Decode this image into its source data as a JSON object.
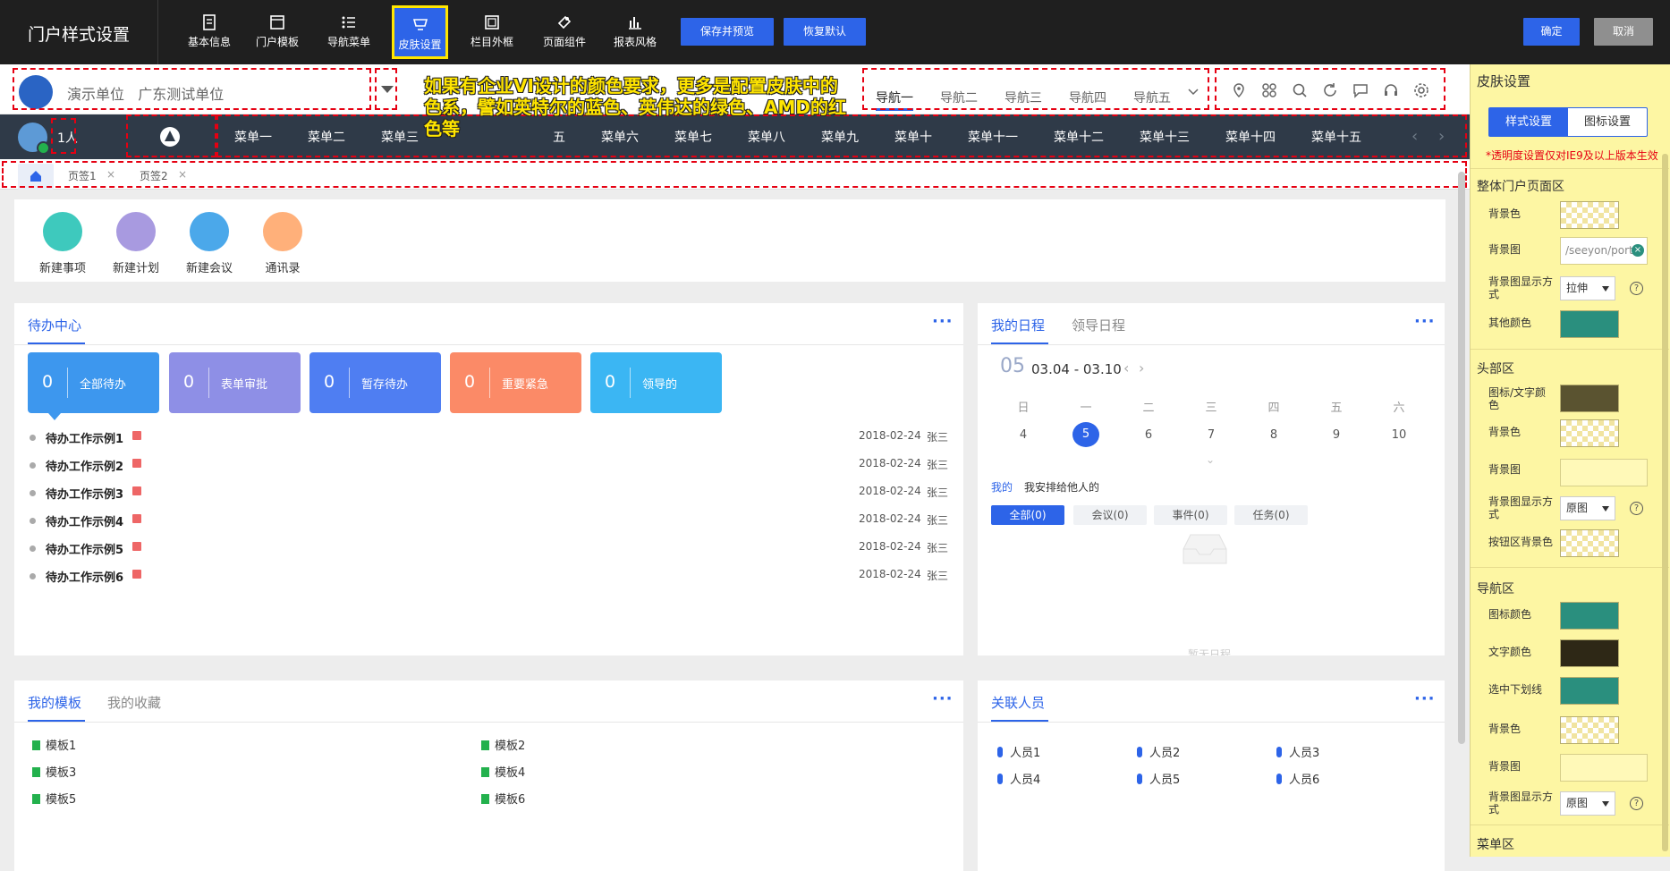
{
  "toolbar": {
    "title": "门户样式设置",
    "tools": [
      "基本信息",
      "门户模板",
      "导航菜单",
      "皮肤设置",
      "栏目外框",
      "页面组件",
      "报表风格"
    ],
    "save_preview": "保存并预览",
    "restore_default": "恢复默认",
    "confirm": "确定",
    "cancel": "取消"
  },
  "header": {
    "unit_name": "演示单位",
    "unit_sub": "广东测试单位",
    "annotation": "如果有企业VI设计的颜色要求，更多是配置皮肤中的色系，譬如英特尔的蓝色、英伟达的绿色、AMD的红色等",
    "top_nav": [
      "导航一",
      "导航二",
      "导航三",
      "导航四",
      "导航五"
    ]
  },
  "menubar": {
    "online": "1人",
    "menus": [
      "菜单一",
      "菜单二",
      "菜单三",
      "五",
      "菜单六",
      "菜单七",
      "菜单八",
      "菜单九",
      "菜单十",
      "菜单十一",
      "菜单十二",
      "菜单十三",
      "菜单十四",
      "菜单十五"
    ]
  },
  "tabs": [
    "页签1",
    "页签2"
  ],
  "quick": [
    "新建事项",
    "新建计划",
    "新建会议",
    "通讯录"
  ],
  "todo": {
    "title": "待办中心",
    "tiles": [
      {
        "count": "0",
        "label": "全部待办"
      },
      {
        "count": "0",
        "label": "表单审批"
      },
      {
        "count": "0",
        "label": "暂存待办"
      },
      {
        "count": "0",
        "label": "重要紧急"
      },
      {
        "count": "0",
        "label": "领导的"
      }
    ],
    "rows": [
      {
        "title": "待办工作示例1",
        "date": "2018-02-24",
        "person": "张三"
      },
      {
        "title": "待办工作示例2",
        "date": "2018-02-24",
        "person": "张三"
      },
      {
        "title": "待办工作示例3",
        "date": "2018-02-24",
        "person": "张三"
      },
      {
        "title": "待办工作示例4",
        "date": "2018-02-24",
        "person": "张三"
      },
      {
        "title": "待办工作示例5",
        "date": "2018-02-24",
        "person": "张三"
      },
      {
        "title": "待办工作示例6",
        "date": "2018-02-24",
        "person": "张三"
      }
    ]
  },
  "schedule": {
    "tab1": "我的日程",
    "tab2": "领导日程",
    "month": "05",
    "range": "03.04 - 03.10",
    "weekdays": [
      "日",
      "一",
      "二",
      "三",
      "四",
      "五",
      "六"
    ],
    "days": [
      "4",
      "5",
      "6",
      "7",
      "8",
      "9",
      "10"
    ],
    "sub1": "我的",
    "sub2": "我安排给他人的",
    "filters": [
      "全部(0)",
      "会议(0)",
      "事件(0)",
      "任务(0)"
    ],
    "empty": "暂无日程"
  },
  "templates": {
    "tab1": "我的模板",
    "tab2": "我的收藏",
    "items": [
      "模板1",
      "模板2",
      "模板3",
      "模板4",
      "模板5",
      "模板6"
    ]
  },
  "people": {
    "title": "关联人员",
    "items": [
      "人员1",
      "人员2",
      "人员3",
      "人员4",
      "人员5",
      "人员6"
    ]
  },
  "panel": {
    "title": "皮肤设置",
    "tab_style": "样式设置",
    "tab_icon": "图标设置",
    "ie_note": "*透明度设置仅对IE9及以上版本生效",
    "s1": {
      "title": "整体门户页面区",
      "bg_color": "背景色",
      "bg_img": "背景图",
      "bg_img_value": "/seeyon/porta",
      "bg_mode": "背景图显示方式",
      "bg_mode_value": "拉伸",
      "other": "其他颜色"
    },
    "s2": {
      "title": "头部区",
      "icon_text": "图标/文字颜色",
      "bg_color": "背景色",
      "bg_img": "背景图",
      "bg_mode": "背景图显示方式",
      "bg_mode_value": "原图",
      "btn_bg": "按钮区背景色"
    },
    "s3": {
      "title": "导航区",
      "icon_color": "图标颜色",
      "text_color": "文字颜色",
      "underline": "选中下划线",
      "bg_color": "背景色",
      "bg_img": "背景图",
      "bg_mode": "背景图显示方式",
      "bg_mode_value": "原图"
    },
    "s4": {
      "title": "菜单区"
    },
    "colors": {
      "teal": "#2a8f7e",
      "dark_olive": "#5a5330",
      "dark_brown": "#2e2816"
    }
  }
}
